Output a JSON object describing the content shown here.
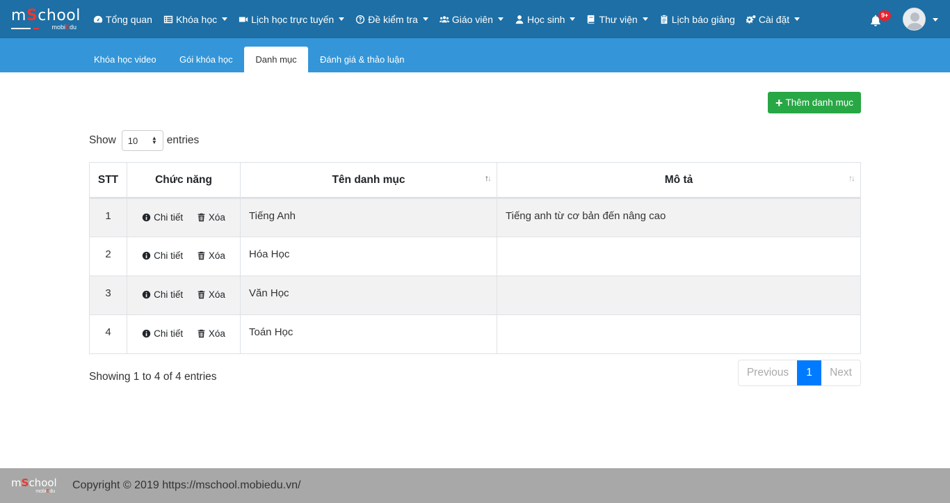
{
  "logo": {
    "m": "m",
    "s": "S",
    "chool": "chool",
    "mobi": "mobi",
    "e": "E",
    "du": "du"
  },
  "nav": [
    {
      "label": "Tổng quan",
      "icon": "dashboard-icon",
      "dropdown": false
    },
    {
      "label": "Khóa học",
      "icon": "list-icon",
      "dropdown": true
    },
    {
      "label": "Lịch học trực tuyến",
      "icon": "video-icon",
      "dropdown": true
    },
    {
      "label": "Đề kiểm tra",
      "icon": "question-circle-icon",
      "dropdown": true
    },
    {
      "label": "Giáo viên",
      "icon": "users-icon",
      "dropdown": true
    },
    {
      "label": "Học sinh",
      "icon": "user-icon",
      "dropdown": true
    },
    {
      "label": "Thư viện",
      "icon": "book-icon",
      "dropdown": true
    },
    {
      "label": "Lịch báo giảng",
      "icon": "clipboard-icon",
      "dropdown": false
    },
    {
      "label": "Cài đặt",
      "icon": "cogs-icon",
      "dropdown": true
    }
  ],
  "notifications": {
    "badge": "9+"
  },
  "tabs": [
    {
      "label": "Khóa học video"
    },
    {
      "label": "Gói khóa học"
    },
    {
      "label": "Danh mục",
      "active": true
    },
    {
      "label": "Đánh giá & thảo luận"
    }
  ],
  "add_button": {
    "label": "Thêm danh mục"
  },
  "show_entries": {
    "prefix": "Show",
    "value": "10",
    "suffix": "entries"
  },
  "table": {
    "headers": [
      "STT",
      "Chức năng",
      "Tên danh mục",
      "Mô tả"
    ],
    "action_labels": {
      "detail": "Chi tiết",
      "delete": "Xóa"
    },
    "rows": [
      {
        "stt": "1",
        "name": "Tiếng Anh",
        "desc": "Tiếng anh từ cơ bản đến nâng cao"
      },
      {
        "stt": "2",
        "name": "Hóa Học",
        "desc": ""
      },
      {
        "stt": "3",
        "name": "Văn Học",
        "desc": ""
      },
      {
        "stt": "4",
        "name": "Toán Học",
        "desc": ""
      }
    ]
  },
  "info": "Showing 1 to 4 of 4 entries",
  "pagination": {
    "prev": "Previous",
    "current": "1",
    "next": "Next"
  },
  "footer": {
    "copyright": "Copyright © 2019 https://mschool.mobiedu.vn/"
  },
  "colors": {
    "navbar": "#1d6fa5",
    "subbar": "#3496d8",
    "add_button": "#28a745",
    "active_page": "#007bff",
    "footer": "#a8a8a8",
    "badge": "#e8222d"
  }
}
